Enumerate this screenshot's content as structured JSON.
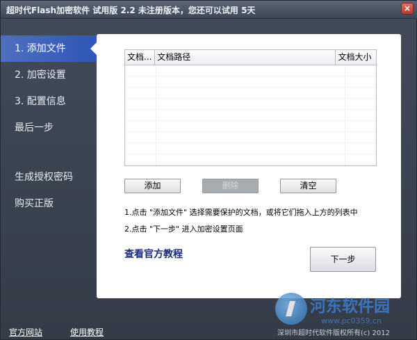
{
  "window": {
    "title": "超时代Flash加密软件 试用版 2.2   未注册版本，您还可以试用 5天",
    "close_label": "×"
  },
  "sidebar": {
    "items": [
      {
        "label": "1. 添加文件",
        "active": true
      },
      {
        "label": "2. 加密设置",
        "active": false
      },
      {
        "label": "3. 配置信息",
        "active": false
      },
      {
        "label": "最后一步",
        "active": false
      }
    ],
    "extra_items": [
      {
        "label": "生成授权密码"
      },
      {
        "label": "购买正版"
      }
    ]
  },
  "file_table": {
    "columns": [
      "文档...",
      "文档路径",
      "文档大小"
    ],
    "rows": []
  },
  "buttons": {
    "add": "添加",
    "delete": "删除",
    "clear": "清空",
    "next": "下一步"
  },
  "hints": {
    "line1": "1.点击 \"添加文件\" 选择需要保护的文档，或将它们拖入上方的列表中",
    "line2": "2.点击 \"下一步\" 进入加密设置页面"
  },
  "tutorial_link": "查看官方教程",
  "footer": {
    "official_site": "官方网站",
    "usage_tutorial": "使用教程",
    "copyright": "深圳市超时代软件版权所有(c) 2012"
  },
  "watermark": {
    "brand": "河东软件园",
    "url": "www.pc0359.cn"
  },
  "colors": {
    "accent": "#2f56b8",
    "link": "#1a2b7a",
    "background": "#3b4554"
  }
}
